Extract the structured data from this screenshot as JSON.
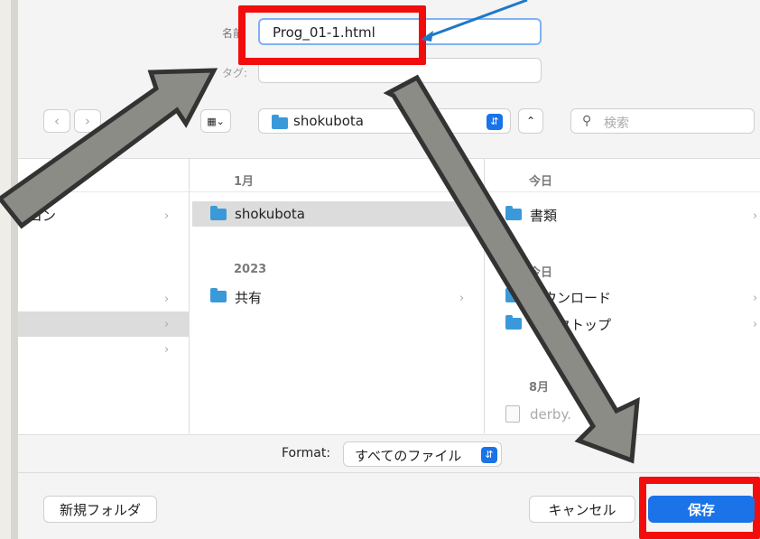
{
  "save_panel": {
    "name_label": "名前",
    "name_value": "Prog_01-1.html",
    "tag_label": "タグ:",
    "location_folder": "shokubota",
    "search_placeholder": "検索",
    "view_icon": "column-view-icon"
  },
  "columns": {
    "col1": {
      "items": [
        {
          "label": "ヨン"
        }
      ]
    },
    "col2": {
      "header": "1月",
      "item_selected": "shokubota",
      "section2_header": "2023",
      "item2": "共有"
    },
    "col3": {
      "header": "今日",
      "item1": "書類",
      "section2_header": "今日",
      "item2": "ダウンロード",
      "item3": "デスクトップ",
      "section3_header": "8月",
      "item4": "derby."
    }
  },
  "format": {
    "label": "Format:",
    "value": "すべてのファイル"
  },
  "buttons": {
    "new_folder": "新規フォルダ",
    "cancel": "キャンセル",
    "save": "保存"
  },
  "colors": {
    "accent": "#1a73e8",
    "highlight": "#f20d0d",
    "arrow": "#8c8c86"
  }
}
